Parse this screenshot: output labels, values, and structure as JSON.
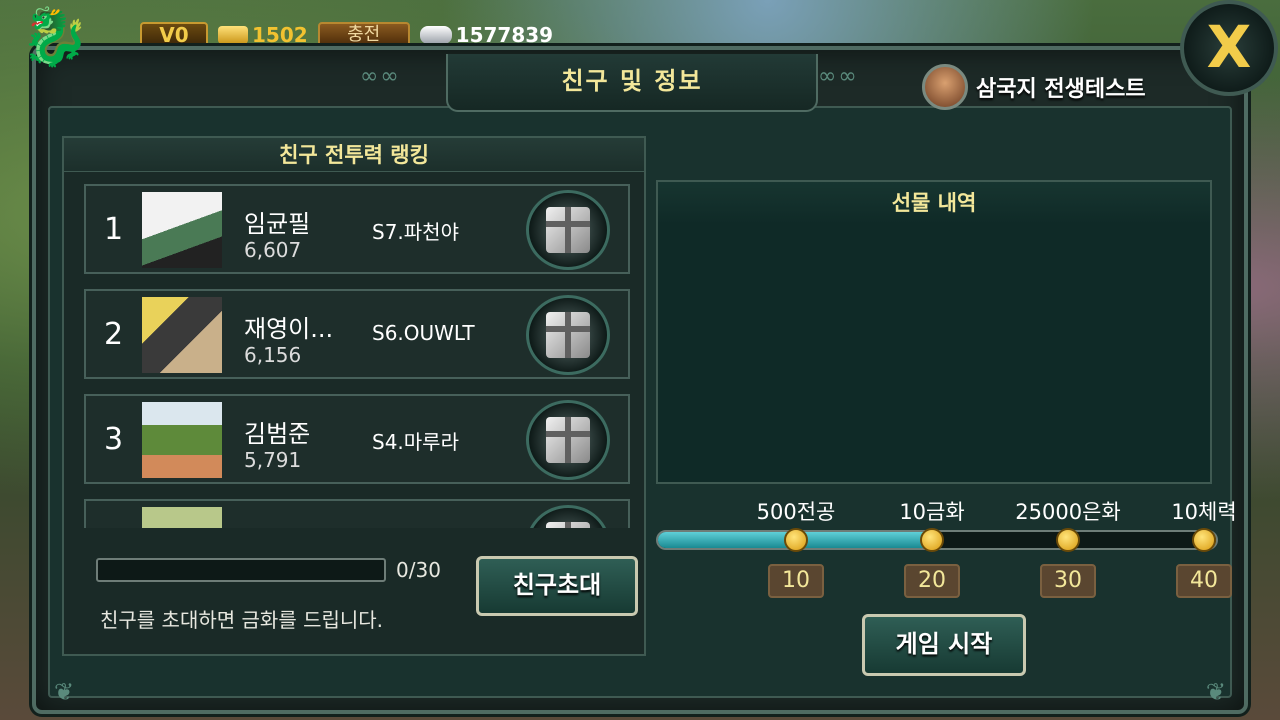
{
  "topbar": {
    "vip_label": "V0",
    "gold_amount": "1502",
    "charge_label": "충전",
    "silver_amount": "1577839"
  },
  "dialog": {
    "title": "친구 및 정보",
    "server_name": "삼국지 전생테스트",
    "close_label": "X"
  },
  "ranking": {
    "header": "친구 전투력 랭킹",
    "rows": [
      {
        "rank": "1",
        "name": "임균필",
        "power": "6,607",
        "server": "S7.파천야"
      },
      {
        "rank": "2",
        "name": "재영이...",
        "power": "6,156",
        "server": "S6.OUWLT"
      },
      {
        "rank": "3",
        "name": "김범준",
        "power": "5,791",
        "server": "S4.마루라"
      }
    ],
    "progress_text": "0/30",
    "progress_value": 0,
    "invite_note": "친구를 초대하면 금화를 드립니다.",
    "invite_button": "친구초대"
  },
  "gift_history": {
    "header": "선물 내역"
  },
  "rewards": {
    "progress_fraction": 0.49,
    "milestones": [
      {
        "reward": "500전공",
        "count": "10"
      },
      {
        "reward": "10금화",
        "count": "20"
      },
      {
        "reward": "25000은화",
        "count": "30"
      },
      {
        "reward": "10체력",
        "count": "40"
      }
    ]
  },
  "start_button": "게임 시작",
  "colors": {
    "accent_gold": "#f3e79a",
    "panel_bg": "#1d2a27",
    "progress_cyan": "#5fd0d8"
  }
}
